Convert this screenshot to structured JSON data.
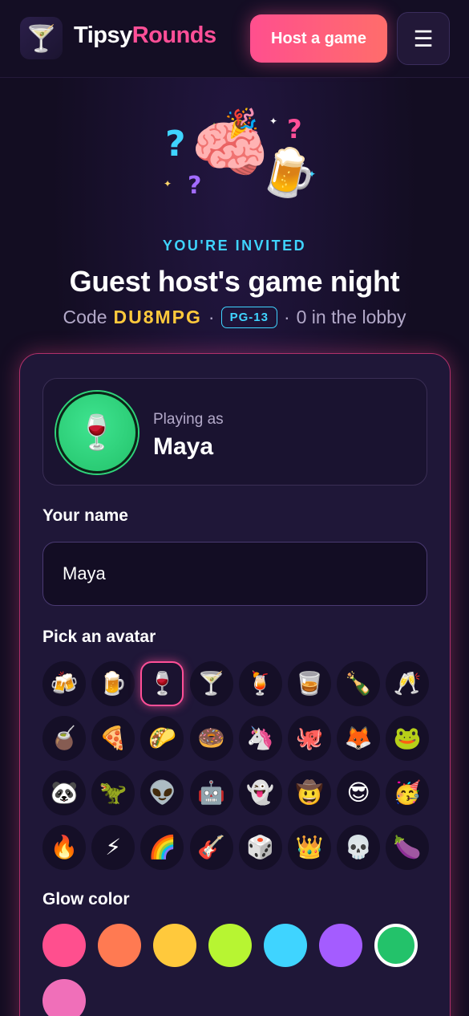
{
  "header": {
    "brand_part1": "Tipsy",
    "brand_part2": "Rounds",
    "logo_icon": "🍸",
    "host_button": "Host a game",
    "menu_icon": "☰"
  },
  "hero": {
    "brain": "🧠",
    "beer": "🍺",
    "party_hat": "🎉"
  },
  "invite": {
    "eyebrow": "YOU'RE INVITED",
    "title": "Guest host's game night",
    "code_label": "Code",
    "code": "DU8MPG",
    "separator": "·",
    "rating": "PG-13",
    "lobby": "0 in the lobby"
  },
  "player": {
    "avatar": "🍷",
    "playing_as_label": "Playing as",
    "name": "Maya"
  },
  "name_field": {
    "label": "Your name",
    "value": "Maya"
  },
  "avatar_picker": {
    "label": "Pick an avatar",
    "selected_index": 2,
    "options": [
      "🍻",
      "🍺",
      "🍷",
      "🍸",
      "🍹",
      "🥃",
      "🍾",
      "🥂",
      "🧉",
      "🍕",
      "🌮",
      "🍩",
      "🦄",
      "🐙",
      "🦊",
      "🐸",
      "🐼",
      "🦖",
      "👽",
      "🤖",
      "👻",
      "🤠",
      "😎",
      "🥳",
      "🔥",
      "⚡",
      "🌈",
      "🎸",
      "🎲",
      "👑",
      "💀",
      "🍆"
    ]
  },
  "glow_picker": {
    "label": "Glow color",
    "selected_index": 6,
    "colors": [
      "#ff4f8e",
      "#ff7a52",
      "#ffc93c",
      "#b7f532",
      "#3fd4ff",
      "#a45cff",
      "#23c26a",
      "#f06fb9"
    ]
  }
}
